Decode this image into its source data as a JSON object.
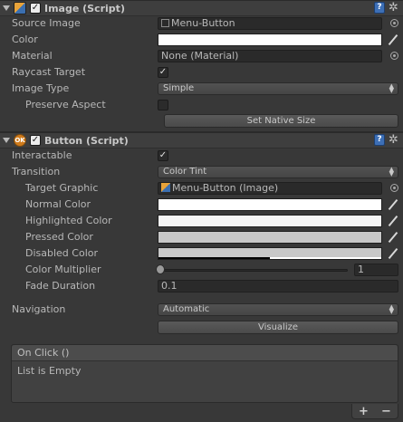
{
  "image_component": {
    "title": "Image (Script)",
    "enabled": true,
    "source_image_label": "Source Image",
    "source_image_value": "Menu-Button",
    "color_label": "Color",
    "material_label": "Material",
    "material_value": "None (Material)",
    "raycast_label": "Raycast Target",
    "raycast_checked": true,
    "image_type_label": "Image Type",
    "image_type_value": "Simple",
    "preserve_aspect_label": "Preserve Aspect",
    "preserve_aspect_checked": false,
    "set_native_size_label": "Set Native Size"
  },
  "button_component": {
    "title": "Button (Script)",
    "icon_text": "OK",
    "enabled": true,
    "interactable_label": "Interactable",
    "interactable_checked": true,
    "transition_label": "Transition",
    "transition_value": "Color Tint",
    "target_graphic_label": "Target Graphic",
    "target_graphic_value": "Menu-Button (Image)",
    "normal_color_label": "Normal Color",
    "highlighted_color_label": "Highlighted Color",
    "pressed_color_label": "Pressed Color",
    "disabled_color_label": "Disabled Color",
    "color_multiplier_label": "Color Multiplier",
    "color_multiplier_value": "1",
    "fade_duration_label": "Fade Duration",
    "fade_duration_value": "0.1",
    "navigation_label": "Navigation",
    "navigation_value": "Automatic",
    "visualize_label": "Visualize",
    "on_click_label": "On Click ()",
    "on_click_empty": "List is Empty"
  },
  "colors": {
    "normal": "#ffffff",
    "highlighted": "#f5f5f5",
    "pressed": "#c8c8c8",
    "disabled": "#c8c8c8"
  },
  "help_icon_text": "?",
  "plus_label": "+",
  "minus_label": "−"
}
